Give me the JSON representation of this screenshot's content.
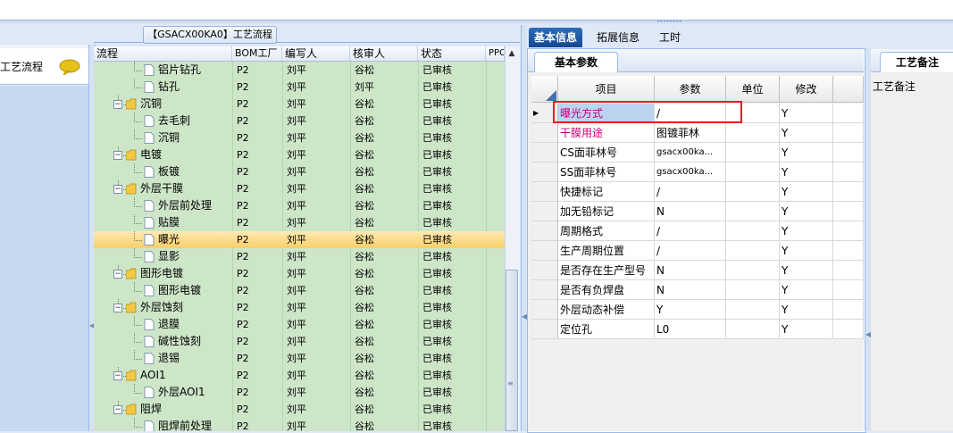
{
  "center": {
    "title": "【GSACX00KA0】工艺流程",
    "columns": [
      "流程",
      "BOM工厂",
      "编写人",
      "核审人",
      "状态",
      "PPC"
    ]
  },
  "left_nav": {
    "item_label": "工艺流程",
    "icon": "chat-bubble-icon"
  },
  "process_rows": [
    {
      "level": 2,
      "type": "doc",
      "name": "铝片钻孔",
      "bom": "P2",
      "writer": "刘平",
      "reviewer": "谷松",
      "status": "已审核"
    },
    {
      "level": 2,
      "type": "doc",
      "name": "钻孔",
      "bom": "P2",
      "writer": "刘平",
      "reviewer": "刘平",
      "status": "已审核"
    },
    {
      "level": 1,
      "type": "folder",
      "name": "沉铜",
      "bom": "P2",
      "writer": "刘平",
      "reviewer": "谷松",
      "status": "已审核"
    },
    {
      "level": 2,
      "type": "doc",
      "name": "去毛刺",
      "bom": "P2",
      "writer": "刘平",
      "reviewer": "谷松",
      "status": "已审核"
    },
    {
      "level": 2,
      "type": "doc",
      "name": "沉铜",
      "bom": "P2",
      "writer": "刘平",
      "reviewer": "谷松",
      "status": "已审核"
    },
    {
      "level": 1,
      "type": "folder",
      "name": "电镀",
      "bom": "P2",
      "writer": "刘平",
      "reviewer": "谷松",
      "status": "已审核"
    },
    {
      "level": 2,
      "type": "doc",
      "name": "板镀",
      "bom": "P2",
      "writer": "刘平",
      "reviewer": "谷松",
      "status": "已审核"
    },
    {
      "level": 1,
      "type": "folder",
      "name": "外层干膜",
      "bom": "P2",
      "writer": "刘平",
      "reviewer": "谷松",
      "status": "已审核"
    },
    {
      "level": 2,
      "type": "doc",
      "name": "外层前处理",
      "bom": "P2",
      "writer": "刘平",
      "reviewer": "谷松",
      "status": "已审核"
    },
    {
      "level": 2,
      "type": "doc",
      "name": "贴膜",
      "bom": "P2",
      "writer": "刘平",
      "reviewer": "谷松",
      "status": "已审核"
    },
    {
      "level": 2,
      "type": "doc",
      "name": "曝光",
      "bom": "P2",
      "writer": "刘平",
      "reviewer": "谷松",
      "status": "已审核",
      "selected": true
    },
    {
      "level": 2,
      "type": "doc",
      "name": "显影",
      "bom": "P2",
      "writer": "刘平",
      "reviewer": "谷松",
      "status": "已审核"
    },
    {
      "level": 1,
      "type": "folder",
      "name": "图形电镀",
      "bom": "P2",
      "writer": "刘平",
      "reviewer": "谷松",
      "status": "已审核"
    },
    {
      "level": 2,
      "type": "doc",
      "name": "图形电镀",
      "bom": "P2",
      "writer": "刘平",
      "reviewer": "谷松",
      "status": "已审核"
    },
    {
      "level": 1,
      "type": "folder",
      "name": "外层蚀刻",
      "bom": "P2",
      "writer": "刘平",
      "reviewer": "谷松",
      "status": "已审核"
    },
    {
      "level": 2,
      "type": "doc",
      "name": "退膜",
      "bom": "P2",
      "writer": "刘平",
      "reviewer": "谷松",
      "status": "已审核"
    },
    {
      "level": 2,
      "type": "doc",
      "name": "碱性蚀刻",
      "bom": "P2",
      "writer": "刘平",
      "reviewer": "谷松",
      "status": "已审核"
    },
    {
      "level": 2,
      "type": "doc",
      "name": "退锡",
      "bom": "P2",
      "writer": "刘平",
      "reviewer": "谷松",
      "status": "已审核"
    },
    {
      "level": 1,
      "type": "folder",
      "name": "AOI1",
      "bom": "P2",
      "writer": "刘平",
      "reviewer": "谷松",
      "status": "已审核"
    },
    {
      "level": 2,
      "type": "doc",
      "name": "外层AOI1",
      "bom": "P2",
      "writer": "刘平",
      "reviewer": "谷松",
      "status": "已审核"
    },
    {
      "level": 1,
      "type": "folder",
      "name": "阻焊",
      "bom": "P2",
      "writer": "刘平",
      "reviewer": "谷松",
      "status": "已审核"
    },
    {
      "level": 2,
      "type": "doc",
      "name": "阻焊前处理",
      "bom": "P2",
      "writer": "刘平",
      "reviewer": "谷松",
      "status": "已审核"
    }
  ],
  "right": {
    "tabs": [
      "基本信息",
      "拓展信息",
      "工时"
    ],
    "subtab": "基本参数",
    "columns": [
      "项目",
      "参数",
      "单位",
      "修改"
    ],
    "remarks_tab": "工艺备注",
    "remarks_label": "工艺备注"
  },
  "param_rows": [
    {
      "item": "曝光方式",
      "value": "/",
      "unit": "",
      "modify": "Y",
      "color": "#c0007a",
      "current": true
    },
    {
      "item": "干膜用途",
      "value": "图镀菲林",
      "unit": "",
      "modify": "Y",
      "color": "#c0007a"
    },
    {
      "item": "CS面菲林号",
      "value": "gsacx00ka...",
      "unit": "",
      "modify": "Y",
      "small": true
    },
    {
      "item": "SS面菲林号",
      "value": "gsacx00ka...",
      "unit": "",
      "modify": "Y",
      "small": true
    },
    {
      "item": "快捷标记",
      "value": "/",
      "unit": "",
      "modify": "Y"
    },
    {
      "item": "加无铅标记",
      "value": "N",
      "unit": "",
      "modify": "Y"
    },
    {
      "item": "周期格式",
      "value": "/",
      "unit": "",
      "modify": "Y"
    },
    {
      "item": "生产周期位置",
      "value": "/",
      "unit": "",
      "modify": "Y"
    },
    {
      "item": "是否存在生产型号",
      "value": "N",
      "unit": "",
      "modify": "Y"
    },
    {
      "item": "是否有负焊盘",
      "value": "N",
      "unit": "",
      "modify": "Y"
    },
    {
      "item": "外层动态补偿",
      "value": "Y",
      "unit": "",
      "modify": "Y"
    },
    {
      "item": "定位孔",
      "value": "L0",
      "unit": "",
      "modify": "Y"
    }
  ]
}
